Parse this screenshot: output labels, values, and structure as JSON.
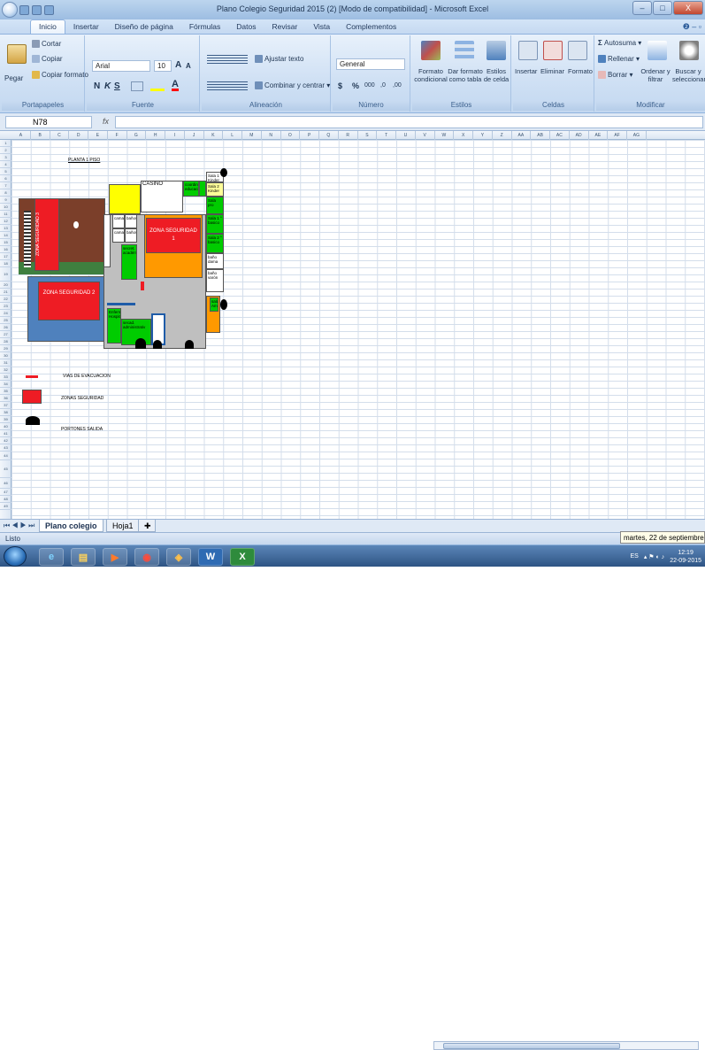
{
  "window": {
    "title": "Plano Colegio Seguridad 2015 (2) [Modo de compatibilidad] - Microsoft Excel",
    "min": "–",
    "max": "□",
    "close": "X"
  },
  "ribbon_tabs": [
    "Inicio",
    "Insertar",
    "Diseño de página",
    "Fórmulas",
    "Datos",
    "Revisar",
    "Vista",
    "Complementos"
  ],
  "ribbon": {
    "clipboard": {
      "paste": "Pegar",
      "cut": "Cortar",
      "copy": "Copiar",
      "format_painter": "Copiar formato",
      "label": "Portapapeles"
    },
    "font": {
      "name": "Arial",
      "size": "10",
      "bold": "N",
      "italic": "K",
      "underline": "S",
      "grow": "A",
      "shrink": "A",
      "label": "Fuente"
    },
    "alignment": {
      "wrap": "Ajustar texto",
      "merge": "Combinar y centrar",
      "label": "Alineación"
    },
    "number": {
      "format": "General",
      "currency": "$",
      "percent": "%",
      "thousands": "000",
      "dec_inc": ",0",
      "dec_dec": ",00",
      "label": "Número"
    },
    "styles": {
      "conditional": "Formato condicional",
      "table": "Dar formato como tabla",
      "cell": "Estilos de celda",
      "label": "Estilos"
    },
    "cells": {
      "insert": "Insertar",
      "delete": "Eliminar",
      "format": "Formato",
      "label": "Celdas"
    },
    "editing": {
      "autosum": "Autosuma",
      "fill": "Rellenar",
      "clear": "Borrar",
      "sort": "Ordenar y filtrar",
      "find": "Buscar y seleccionar",
      "label": "Modificar"
    }
  },
  "formula_bar": {
    "cell_ref": "N78",
    "fx": "fx",
    "value": ""
  },
  "columns": [
    "A",
    "B",
    "C",
    "D",
    "E",
    "F",
    "G",
    "H",
    "I",
    "J",
    "K",
    "L",
    "M",
    "N",
    "O",
    "P",
    "Q",
    "R",
    "S",
    "T",
    "U",
    "V",
    "W",
    "X",
    "Y",
    "Z",
    "AA",
    "AB",
    "AC",
    "AD",
    "AE",
    "AF",
    "AG"
  ],
  "rows": [
    "1",
    "2",
    "3",
    "4",
    "5",
    "6",
    "7",
    "8",
    "9",
    "10",
    "11",
    "12",
    "13",
    "14",
    "15",
    "16",
    "17",
    "18",
    "19",
    "20",
    "21",
    "22",
    "23",
    "24",
    "25",
    "26",
    "27",
    "28",
    "29",
    "30",
    "31",
    "32",
    "33",
    "34",
    "35",
    "36",
    "37",
    "38",
    "39",
    "40",
    "41",
    "42",
    "43",
    "44",
    "45",
    "46",
    "47",
    "48",
    "49"
  ],
  "plan": {
    "title": "PLANTA 1 PISO",
    "casino": "CASINO",
    "zona1": "ZONA SEGURIDAD 1",
    "zona2": "ZONA SEGURIDAD 2",
    "zona3": "ZONA SEGURIDAD 3",
    "coord": "coordinad educacional",
    "sala1": "Sala 1 Kinder",
    "sala2": "Sala 2 Kinder",
    "sala_pro": "Sala pro",
    "sala3": "Sala 1 ° basico",
    "sala4": "Sala 2 ° basico",
    "bano_dam": "baño dama",
    "bano_var": "baño varón",
    "camarin1": "camarin",
    "banos1": "baños",
    "camarin2": "camarin",
    "banos2": "baños",
    "secre": "secret. académica",
    "enfer": "Enfermeria Hospital",
    "secad": "secad. administrativ",
    "salaA": "sala Amp"
  },
  "legend": {
    "evac": "VIAS DE EVACUACION",
    "zones": "ZONAS SEGURIDAD",
    "gates": "PORTONES SALIDA"
  },
  "colors": {
    "zone": "#ee1c24",
    "casino": "#ffff00",
    "green": "#00cc00",
    "orange": "#ff9900",
    "blue": "#4f81bd",
    "gray": "#bfbfbf",
    "court": "#7b3f2a"
  },
  "sheets": [
    "Plano colegio",
    "Hoja1"
  ],
  "status": {
    "ready": "Listo",
    "tooltip": "martes, 22 de septiembre de 2"
  },
  "tray": {
    "lang": "ES",
    "time": "12:19",
    "date": "22-09-2015"
  }
}
